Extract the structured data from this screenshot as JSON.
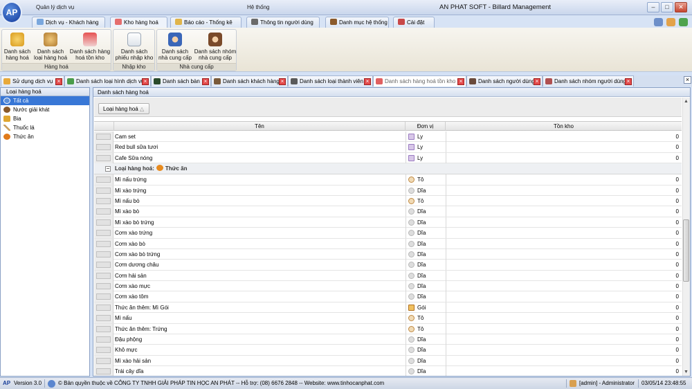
{
  "titlebar": {
    "left_menu": "Quản lý dịch vụ",
    "right_menu": "Hệ thống",
    "app_title": "AN PHAT SOFT - Billard Management",
    "logo_text": "AP"
  },
  "ribbon_tabs": [
    {
      "label": "Dịch vụ - Khách hàng"
    },
    {
      "label": "Kho hàng hoá"
    },
    {
      "label": "Báo cáo - Thống kê"
    },
    {
      "label": "Thông tin người dùng"
    },
    {
      "label": "Danh mục hệ thống"
    },
    {
      "label": "Cài đặt"
    }
  ],
  "ribbon": {
    "groups": [
      {
        "label": "Hàng hoá",
        "buttons": [
          {
            "label": "Danh sách hàng hoá"
          },
          {
            "label": "Danh sách loại hàng hoá"
          },
          {
            "label": "Danh sách hàng hoá tồn kho"
          }
        ]
      },
      {
        "label": "Nhập kho",
        "buttons": [
          {
            "label": "Danh sách phiếu nhập kho"
          }
        ]
      },
      {
        "label": "Nhà cung cấp",
        "buttons": [
          {
            "label": "Danh sách nhà cung cấp"
          },
          {
            "label": "Danh sách nhóm nhà cung cấp"
          }
        ]
      }
    ]
  },
  "doc_tabs": [
    {
      "label": "Sử dụng dịch vụ"
    },
    {
      "label": "Danh sách loại hình dịch vụ"
    },
    {
      "label": "Danh sách bàn"
    },
    {
      "label": "Danh sách khách hàng"
    },
    {
      "label": "Danh sách loại thành viên"
    },
    {
      "label": "Danh sách hàng hoá tồn kho"
    },
    {
      "label": "Danh sách người dùng"
    },
    {
      "label": "Danh sách nhóm người dùng"
    }
  ],
  "left_panel": {
    "title": "Loại hàng hoá",
    "items": [
      {
        "label": "Tất cả"
      },
      {
        "label": "Nước giải khát"
      },
      {
        "label": "Bia"
      },
      {
        "label": "Thuốc lá"
      },
      {
        "label": "Thức ăn"
      }
    ]
  },
  "main_panel": {
    "title": "Danh sách hàng hoá",
    "group_chip": "Loại hàng hoá",
    "columns": [
      "Tên",
      "Đơn vị",
      "Tồn kho"
    ],
    "rows_top": [
      {
        "name": "Cam set",
        "unit": "Ly",
        "icon": "cup-icon",
        "qty": "0"
      },
      {
        "name": "Red bull sữa tươi",
        "unit": "Ly",
        "icon": "cup-icon",
        "qty": "0"
      },
      {
        "name": "Cafe Sữa nóng",
        "unit": "Ly",
        "icon": "cup-icon",
        "qty": "0"
      }
    ],
    "group_row": {
      "label": "Loại hàng hoá:",
      "value": "Thức ăn"
    },
    "rows_group": [
      {
        "name": "Mì nấu trứng",
        "unit": "Tô",
        "icon": "bowl-icon",
        "qty": "0"
      },
      {
        "name": "Mì xào trứng",
        "unit": "Dĩa",
        "icon": "plate-icon",
        "qty": "0"
      },
      {
        "name": "Mì nấu bò",
        "unit": "Tô",
        "icon": "bowl-icon",
        "qty": "0"
      },
      {
        "name": "Mì xào bò",
        "unit": "Dĩa",
        "icon": "plate-icon",
        "qty": "0"
      },
      {
        "name": "Mì xào bò trứng",
        "unit": "Dĩa",
        "icon": "plate-icon",
        "qty": "0"
      },
      {
        "name": "Cơm xào trứng",
        "unit": "Dĩa",
        "icon": "plate-icon",
        "qty": "0"
      },
      {
        "name": "Cơm xào bò",
        "unit": "Dĩa",
        "icon": "plate-icon",
        "qty": "0"
      },
      {
        "name": "Cơm xào bò trứng",
        "unit": "Dĩa",
        "icon": "plate-icon",
        "qty": "0"
      },
      {
        "name": "Cơm dương châu",
        "unit": "Dĩa",
        "icon": "plate-icon",
        "qty": "0"
      },
      {
        "name": "Cơm hải sản",
        "unit": "Dĩa",
        "icon": "plate-icon",
        "qty": "0"
      },
      {
        "name": "Cơm xào mực",
        "unit": "Dĩa",
        "icon": "plate-icon",
        "qty": "0"
      },
      {
        "name": "Cơm xào tôm",
        "unit": "Dĩa",
        "icon": "plate-icon",
        "qty": "0"
      },
      {
        "name": "Thức ăn thêm: Mì Gói",
        "unit": "Gói",
        "icon": "pack-icon",
        "qty": "0"
      },
      {
        "name": "Mì nấu",
        "unit": "Tô",
        "icon": "bowl-icon",
        "qty": "0"
      },
      {
        "name": "Thức ăn thêm: Trứng",
        "unit": "Tô",
        "icon": "bowl-icon",
        "qty": "0"
      },
      {
        "name": "Đậu phộng",
        "unit": "Dĩa",
        "icon": "plate-icon",
        "qty": "0"
      },
      {
        "name": "Khô mực",
        "unit": "Dĩa",
        "icon": "plate-icon",
        "qty": "0"
      },
      {
        "name": "Mì xào hải sản",
        "unit": "Dĩa",
        "icon": "plate-icon",
        "qty": "0"
      },
      {
        "name": "Trái cây dĩa",
        "unit": "Dĩa",
        "icon": "plate-icon",
        "qty": "0"
      }
    ]
  },
  "statusbar": {
    "version": "Version 3.0",
    "copyright": "© Bản quyền thuộc về CÔNG TY TNHH GIẢI PHÁP TIN HỌC AN PHÁT  -- Hỗ trợ: (08) 6676 2848  -- Website: www.tinhocanphat.com",
    "user": "[admin] - Administrator",
    "datetime": "03/05/14 23:48:55"
  }
}
